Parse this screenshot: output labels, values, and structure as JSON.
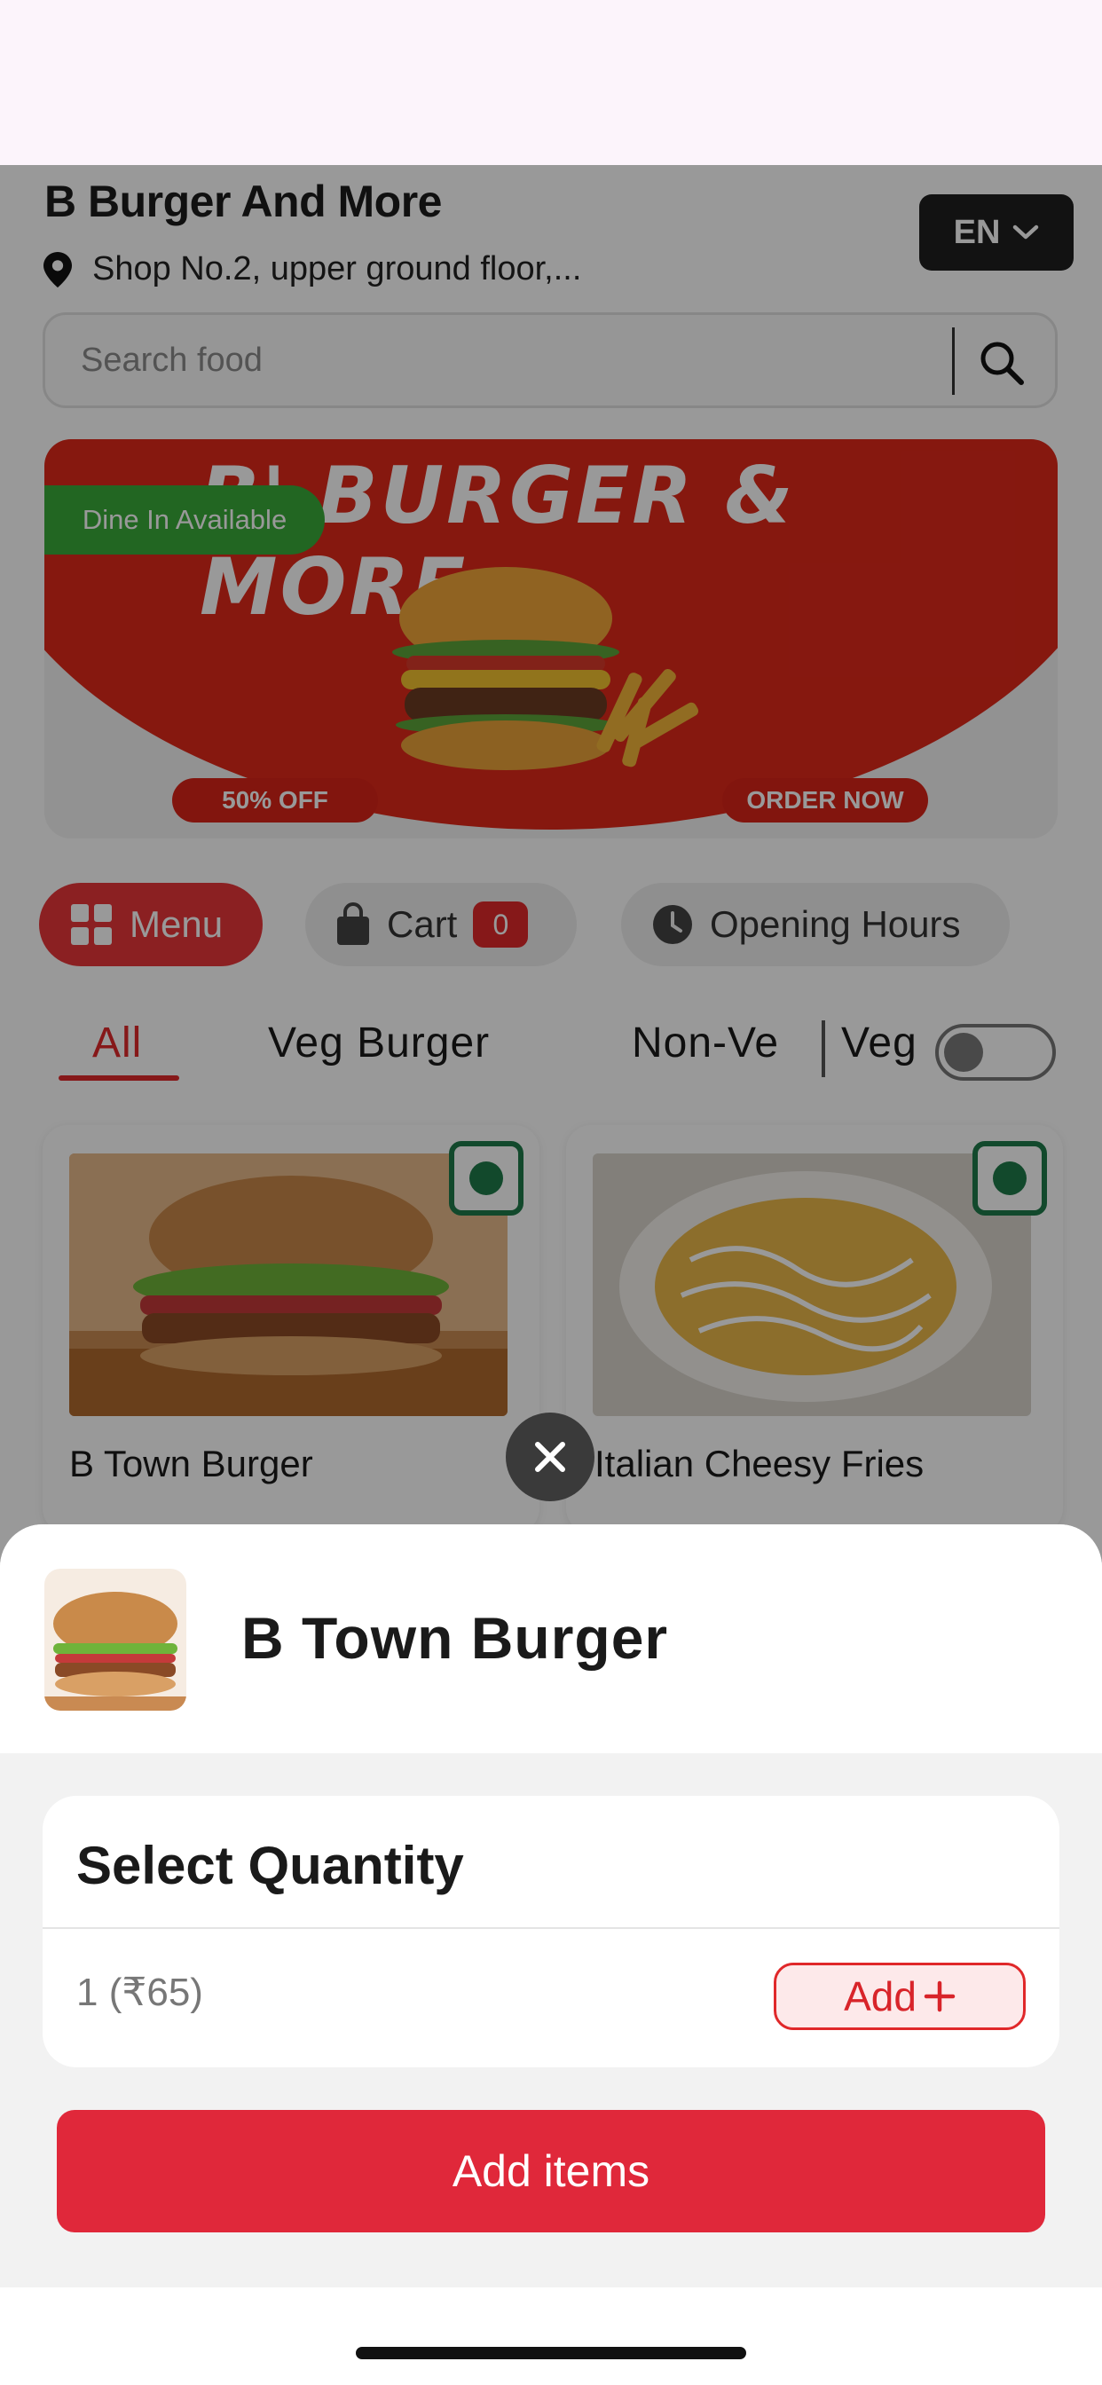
{
  "store": {
    "name": "B Burger And More",
    "address": "Shop No.2, upper ground floor,...",
    "language": "EN"
  },
  "search": {
    "placeholder": "Search food"
  },
  "banner": {
    "title": "B' BURGER & MORE",
    "dine_in": "Dine In Available",
    "discount": "50% OFF",
    "cta": "ORDER NOW"
  },
  "nav_tabs": {
    "menu": "Menu",
    "cart": "Cart",
    "cart_count": "0",
    "opening_hours": "Opening Hours"
  },
  "categories": {
    "items": [
      "All",
      "Veg Burger",
      "Non-Ve"
    ],
    "active": "All",
    "veg_toggle_label": "Veg",
    "veg_toggle_on": false
  },
  "products": [
    {
      "name": "B Town Burger"
    },
    {
      "name": "Italian Cheesy Fries"
    }
  ],
  "sheet": {
    "title": "B Town Burger",
    "section_title": "Select Quantity",
    "quantity_option": "1 (₹65)",
    "add_label": "Add",
    "submit_label": "Add items"
  },
  "colors": {
    "accent": "#e0282a",
    "veg_green": "#1f7a4a",
    "dark": "#1e1e1e"
  }
}
